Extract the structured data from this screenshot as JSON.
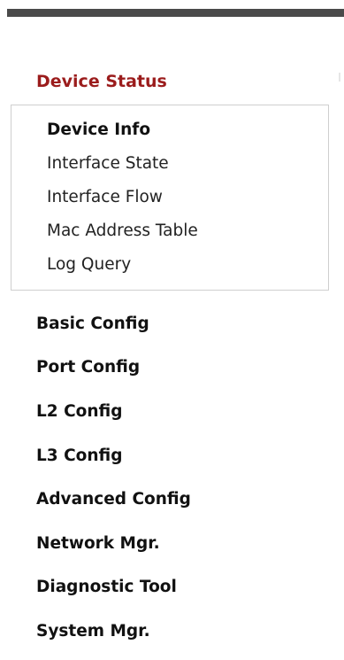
{
  "device_status": {
    "title": "Device Status",
    "items": [
      {
        "label": "Device Info",
        "active": true
      },
      {
        "label": "Interface State",
        "active": false
      },
      {
        "label": "Interface Flow",
        "active": false
      },
      {
        "label": "Mac Address Table",
        "active": false
      },
      {
        "label": "Log Query",
        "active": false
      }
    ]
  },
  "menu": {
    "items": [
      {
        "label": "Basic Config"
      },
      {
        "label": "Port Config"
      },
      {
        "label": "L2 Config"
      },
      {
        "label": "L3 Config"
      },
      {
        "label": "Advanced Config"
      },
      {
        "label": "Network Mgr."
      },
      {
        "label": "Diagnostic Tool"
      },
      {
        "label": "System Mgr."
      }
    ]
  },
  "colors": {
    "section_title": "#9b1c1c",
    "top_bar": "#4a4a4a",
    "box_border": "#cfcfcf"
  }
}
